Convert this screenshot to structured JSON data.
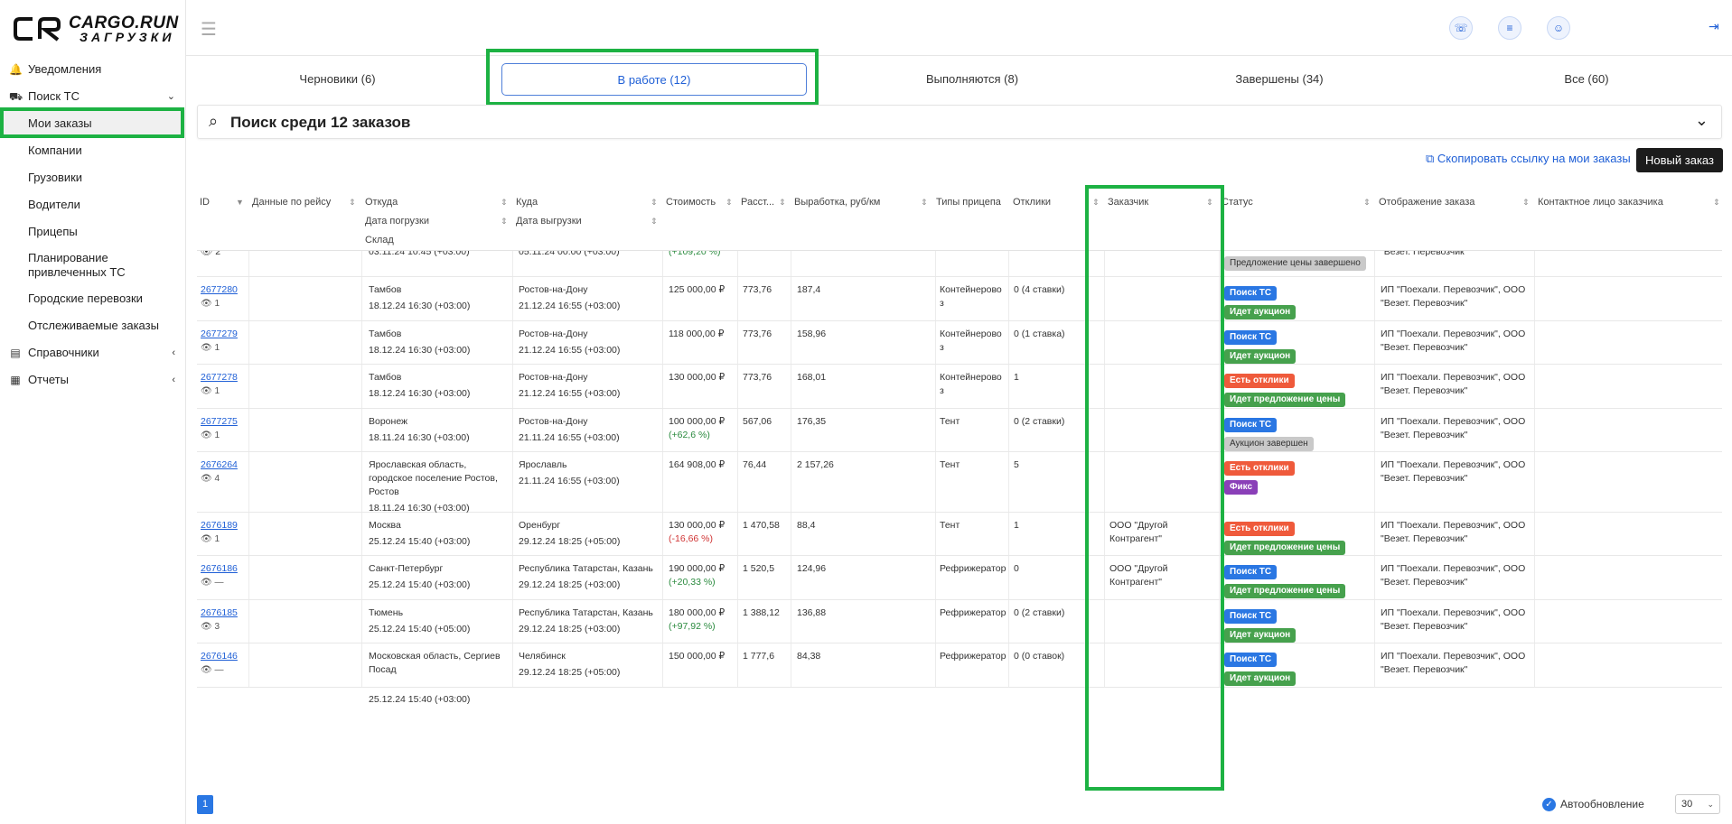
{
  "logo": {
    "line1": "CARGO.RUN",
    "line2": "ЗАГРУЗКИ"
  },
  "sidebar": {
    "items": [
      {
        "label": "Уведомления",
        "icon": "bell-icon"
      },
      {
        "label": "Поиск ТС",
        "icon": "truck-icon",
        "arrow": "⌄"
      },
      {
        "label": "Мои заказы"
      },
      {
        "label": "Компании"
      },
      {
        "label": "Грузовики"
      },
      {
        "label": "Водители"
      },
      {
        "label": "Прицепы"
      },
      {
        "label": "Планирование привлеченных ТС"
      },
      {
        "label": "Городские перевозки"
      },
      {
        "label": "Отслеживаемые заказы"
      },
      {
        "label": "Справочники",
        "icon": "book-icon",
        "arrow": "‹"
      },
      {
        "label": "Отчеты",
        "icon": "report-icon",
        "arrow": "‹"
      }
    ]
  },
  "tabs": [
    {
      "label": "Черновики (6)"
    },
    {
      "label": "В работе (12)"
    },
    {
      "label": "Выполняются (8)"
    },
    {
      "label": "Завершены (34)"
    },
    {
      "label": "Все (60)"
    }
  ],
  "search": {
    "text": "Поиск среди 12 заказов"
  },
  "actions": {
    "copy_link": "Скопировать ссылку на мои заказы",
    "new_order": "Новый заказ"
  },
  "columns": {
    "id": "ID",
    "trip": "Данные по рейсу",
    "from": "Откуда",
    "load_date": "Дата погрузки",
    "warehouse": "Склад",
    "to": "Куда",
    "unload_date": "Дата выгрузки",
    "cost": "Стоимость",
    "dist": "Расст...",
    "rate": "Выработка, руб/км",
    "trailer": "Типы прицепа",
    "responses": "Отклики",
    "customer": "Заказчик",
    "status": "Статус",
    "display": "Отображение заказа",
    "contact": "Контактное лицо заказчика"
  },
  "partial_row": {
    "views": "2",
    "from_date": "03.11.24 10:45 (+03:00)",
    "to_date": "05.11.24 00:00 (+03:00)",
    "cost_delta": "(+109,20 %)",
    "status": "Предложение цены завершено",
    "display": "\"Везет. Перевозчик\""
  },
  "rows": [
    {
      "id": "2677280",
      "views": "1",
      "from": "Тамбов",
      "from_date": "18.12.24 16:30 (+03:00)",
      "to": "Ростов-на-Дону",
      "to_date": "21.12.24 16:55 (+03:00)",
      "cost": "125 000,00 ₽",
      "cost_delta": "",
      "dist": "773,76",
      "rate": "187,4",
      "trailer": "Контейнерово з",
      "responses": "0 (4 ставки)",
      "customer": "",
      "badges": [
        {
          "text": "Поиск ТС",
          "color": "blue"
        },
        {
          "text": "Идет аукцион",
          "color": "green"
        }
      ],
      "display": "ИП \"Поехали. Перевозчик\", ООО \"Везет. Перевозчик\""
    },
    {
      "id": "2677279",
      "views": "1",
      "from": "Тамбов",
      "from_date": "18.12.24 16:30 (+03:00)",
      "to": "Ростов-на-Дону",
      "to_date": "21.12.24 16:55 (+03:00)",
      "cost": "118 000,00 ₽",
      "cost_delta": "",
      "dist": "773,76",
      "rate": "158,96",
      "trailer": "Контейнерово з",
      "responses": "0 (1 ставка)",
      "customer": "",
      "badges": [
        {
          "text": "Поиск ТС",
          "color": "blue"
        },
        {
          "text": "Идет аукцион",
          "color": "green"
        }
      ],
      "display": "ИП \"Поехали. Перевозчик\", ООО \"Везет. Перевозчик\""
    },
    {
      "id": "2677278",
      "views": "1",
      "from": "Тамбов",
      "from_date": "18.12.24 16:30 (+03:00)",
      "to": "Ростов-на-Дону",
      "to_date": "21.12.24 16:55 (+03:00)",
      "cost": "130 000,00 ₽",
      "cost_delta": "",
      "dist": "773,76",
      "rate": "168,01",
      "trailer": "Контейнерово з",
      "responses": "1",
      "customer": "",
      "badges": [
        {
          "text": "Есть отклики",
          "color": "red"
        },
        {
          "text": "Идет предложение цены",
          "color": "green"
        }
      ],
      "display": "ИП \"Поехали. Перевозчик\", ООО \"Везет. Перевозчик\""
    },
    {
      "id": "2677275",
      "views": "1",
      "from": "Воронеж",
      "from_date": "18.11.24 16:30 (+03:00)",
      "to": "Ростов-на-Дону",
      "to_date": "21.11.24 16:55 (+03:00)",
      "cost": "100 000,00 ₽",
      "cost_delta": "(+62,6 %)",
      "cost_sign": "pos",
      "dist": "567,06",
      "rate": "176,35",
      "trailer": "Тент",
      "responses": "0 (2 ставки)",
      "customer": "",
      "badges": [
        {
          "text": "Поиск ТС",
          "color": "blue"
        },
        {
          "text": "Аукцион завершен",
          "color": "gray"
        }
      ],
      "display": "ИП \"Поехали. Перевозчик\", ООО \"Везет. Перевозчик\""
    },
    {
      "id": "2676264",
      "views": "4",
      "from": "Ярославская область, городское поселение Ростов, Ростов",
      "from_date": "18.11.24 16:30 (+03:00)",
      "to": "Ярославль",
      "to_date": "21.11.24 16:55 (+03:00)",
      "cost": "164 908,00 ₽",
      "cost_delta": "",
      "dist": "76,44",
      "rate": "2 157,26",
      "trailer": "Тент",
      "responses": "5",
      "customer": "",
      "badges": [
        {
          "text": "Есть отклики",
          "color": "red"
        },
        {
          "text": "Фикс",
          "color": "purple"
        }
      ],
      "display": "ИП \"Поехали. Перевозчик\", ООО \"Везет. Перевозчик\""
    },
    {
      "id": "2676189",
      "views": "1",
      "from": "Москва",
      "from_date": "25.12.24 15:40 (+03:00)",
      "to": "Оренбург",
      "to_date": "29.12.24 18:25 (+05:00)",
      "cost": "130 000,00 ₽",
      "cost_delta": "(-16,66 %)",
      "cost_sign": "neg",
      "dist": "1 470,58",
      "rate": "88,4",
      "trailer": "Тент",
      "responses": "1",
      "customer": "ООО \"Другой Контрагент\"",
      "badges": [
        {
          "text": "Есть отклики",
          "color": "red"
        },
        {
          "text": "Идет предложение цены",
          "color": "green"
        }
      ],
      "display": "ИП \"Поехали. Перевозчик\", ООО \"Везет. Перевозчик\""
    },
    {
      "id": "2676186",
      "views": "—",
      "from": "Санкт-Петербург",
      "from_date": "25.12.24 15:40 (+03:00)",
      "to": "Республика Татарстан, Казань",
      "to_date": "29.12.24 18:25 (+03:00)",
      "cost": "190 000,00 ₽",
      "cost_delta": "(+20,33 %)",
      "cost_sign": "pos",
      "dist": "1 520,5",
      "rate": "124,96",
      "trailer": "Рефрижератор",
      "responses": "0",
      "customer": "ООО \"Другой Контрагент\"",
      "badges": [
        {
          "text": "Поиск ТС",
          "color": "blue"
        },
        {
          "text": "Идет предложение цены",
          "color": "green"
        }
      ],
      "display": "ИП \"Поехали. Перевозчик\", ООО \"Везет. Перевозчик\""
    },
    {
      "id": "2676185",
      "views": "3",
      "from": "Тюмень",
      "from_date": "25.12.24 15:40 (+05:00)",
      "to": "Республика Татарстан, Казань",
      "to_date": "29.12.24 18:25 (+03:00)",
      "cost": "180 000,00 ₽",
      "cost_delta": "(+97,92 %)",
      "cost_sign": "pos",
      "dist": "1 388,12",
      "rate": "136,88",
      "trailer": "Рефрижератор",
      "responses": "0 (2 ставки)",
      "customer": "",
      "badges": [
        {
          "text": "Поиск ТС",
          "color": "blue"
        },
        {
          "text": "Идет аукцион",
          "color": "green"
        }
      ],
      "display": "ИП \"Поехали. Перевозчик\", ООО \"Везет. Перевозчик\""
    },
    {
      "id": "2676146",
      "views": "—",
      "from": "Московская область, Сергиев Посад",
      "from_date": "25.12.24 15:40 (+03:00)",
      "to": "Челябинск",
      "to_date": "29.12.24 18:25 (+05:00)",
      "cost": "150 000,00 ₽",
      "cost_delta": "",
      "dist": "1 777,6",
      "rate": "84,38",
      "trailer": "Рефрижератор",
      "responses": "0 (0 ставок)",
      "customer": "",
      "badges": [
        {
          "text": "Поиск ТС",
          "color": "blue"
        },
        {
          "text": "Идет аукцион",
          "color": "green"
        }
      ],
      "display": "ИП \"Поехали. Перевозчик\", ООО \"Везет. Перевозчик\""
    }
  ],
  "footer": {
    "page": "1",
    "auto_refresh": "Автообновление",
    "per_page": "30"
  }
}
